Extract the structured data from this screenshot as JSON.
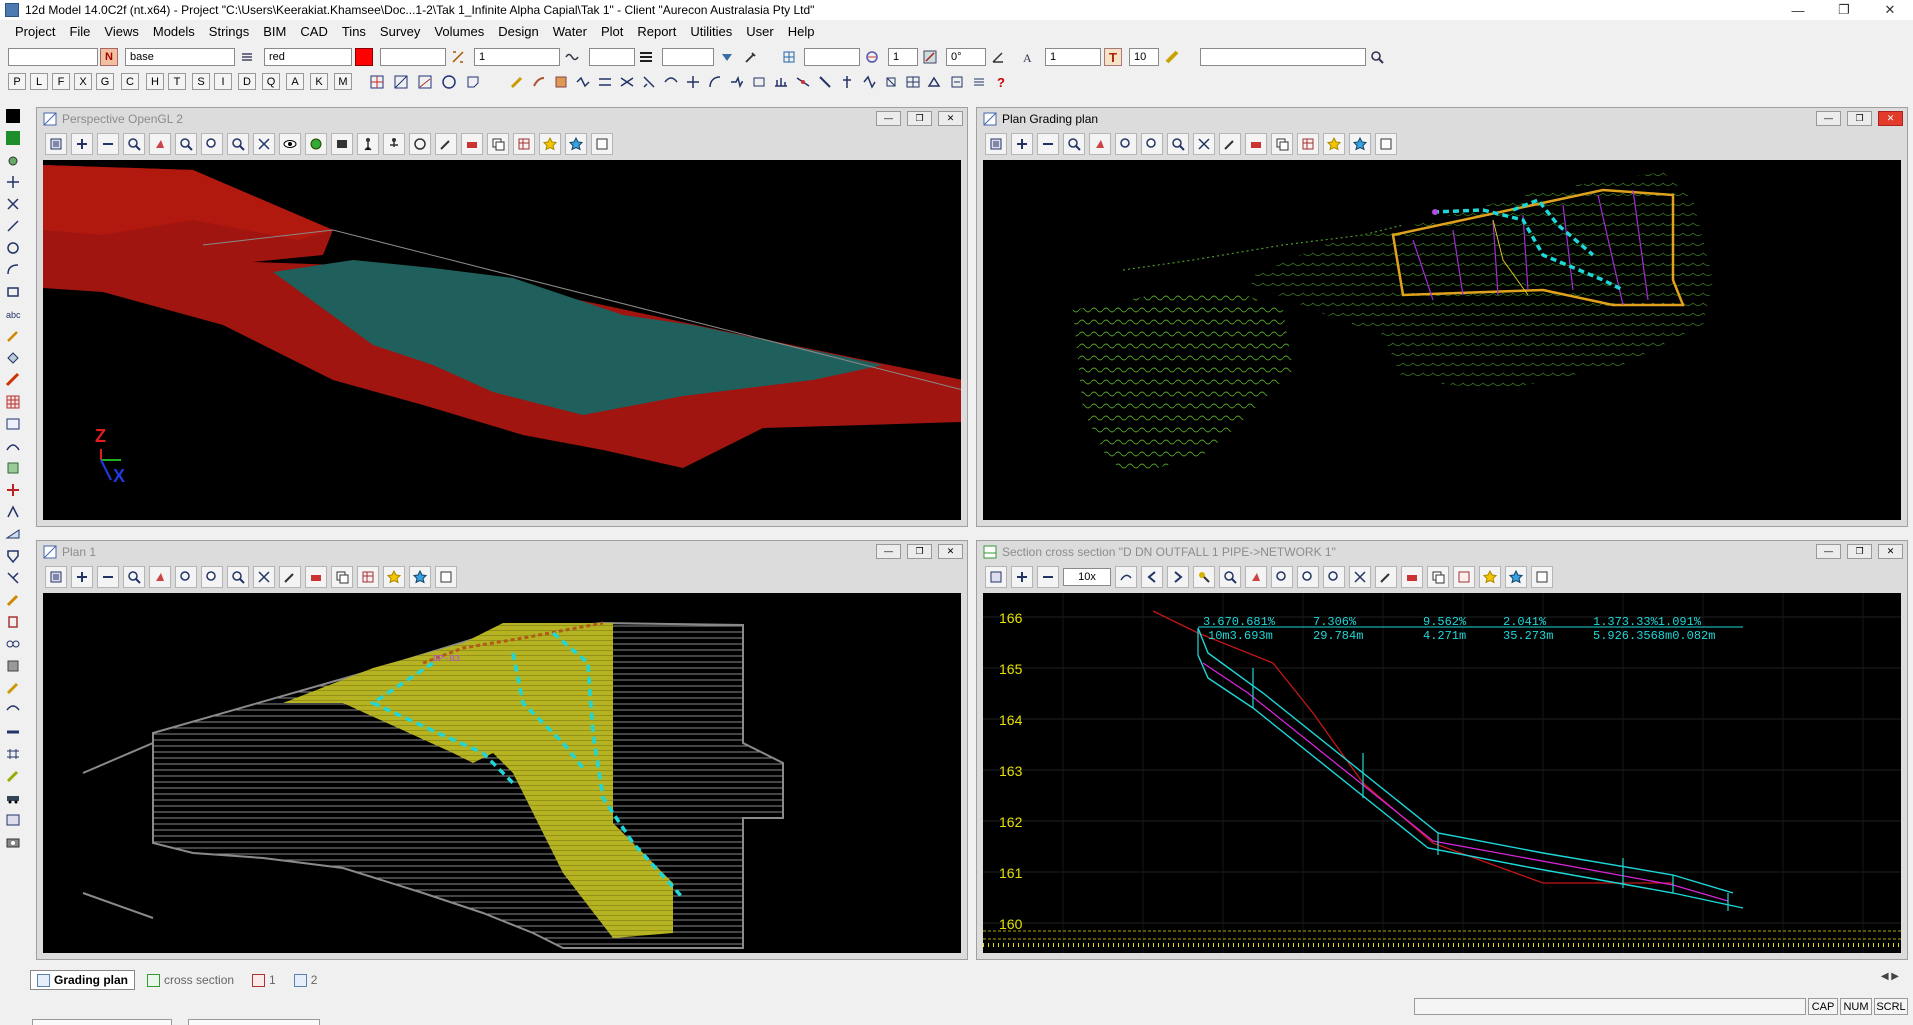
{
  "window": {
    "title": "12d Model  14.0C2f (nt.x64) - Project \"C:\\Users\\Keerakiat.Khamsee\\Doc...1-2\\Tak 1_Infinite Alpha Capial\\Tak 1\" - Client \"Aurecon Australasia Pty Ltd\"",
    "minimize": "—",
    "maximize": "❐",
    "close": "✕"
  },
  "menu": [
    "Project",
    "File",
    "Views",
    "Models",
    "Strings",
    "BIM",
    "CAD",
    "Tins",
    "Survey",
    "Volumes",
    "Design",
    "Water",
    "Plot",
    "Report",
    "Utilities",
    "User",
    "Help"
  ],
  "toolbar": {
    "model_field": "",
    "model_button": "N",
    "name_field": "base",
    "colour_field": "red",
    "colour_swatch": "#ff0000",
    "style_field": "",
    "weight_field": "1",
    "linetype_field": "",
    "weight2_field": "",
    "level_field": "",
    "snap_field": "1",
    "angle_field": "0°",
    "text_field": "1",
    "text_icon": "T",
    "textsize_field": "10",
    "search_field": ""
  },
  "snap_letters": [
    "P",
    "L",
    "F",
    "X",
    "G",
    "C",
    "H",
    "T",
    "S",
    "I",
    "D",
    "Q",
    "A",
    "K",
    "M"
  ],
  "panels": {
    "perspective": {
      "title": "Perspective OpenGL 2",
      "axis_z": "Z",
      "axis_x": "X"
    },
    "plan_grading": {
      "title": "Plan Grading plan"
    },
    "plan1": {
      "title": "Plan 1"
    },
    "section": {
      "title": "Section cross section \"D DN OUTFALL 1 PIPE->NETWORK 1\"",
      "zoom_field": "10x",
      "y_ticks": [
        "166",
        "165",
        "164",
        "163",
        "162",
        "161",
        "160"
      ],
      "grade_labels": [
        "3.670.681%",
        "7.306%",
        "9.562%",
        "2.041%",
        "1.373.33%1.091%"
      ],
      "length_labels": [
        "10m3.693m",
        "29.784m",
        "4.271m",
        "35.273m",
        "5.926.3568m0.082m"
      ]
    }
  },
  "plan1_labels": {
    "dp03": "DP-03"
  },
  "tabs": [
    {
      "label": "Grading plan",
      "active": true
    },
    {
      "label": "cross section",
      "active": false
    },
    {
      "label": "1",
      "active": false
    },
    {
      "label": "2",
      "active": false
    }
  ],
  "status": {
    "cap": "CAP",
    "num": "NUM",
    "scrl": "SCRL"
  },
  "colors": {
    "terrain_red": "#a0150f",
    "water_teal": "#1f5f5c",
    "grading_yellow": "#b5b321",
    "pipe_cyan": "#1ed7d8",
    "contour_green": "#4e9a2a",
    "section_magenta": "#d626d6",
    "section_tick_yellow": "#e6e000"
  }
}
